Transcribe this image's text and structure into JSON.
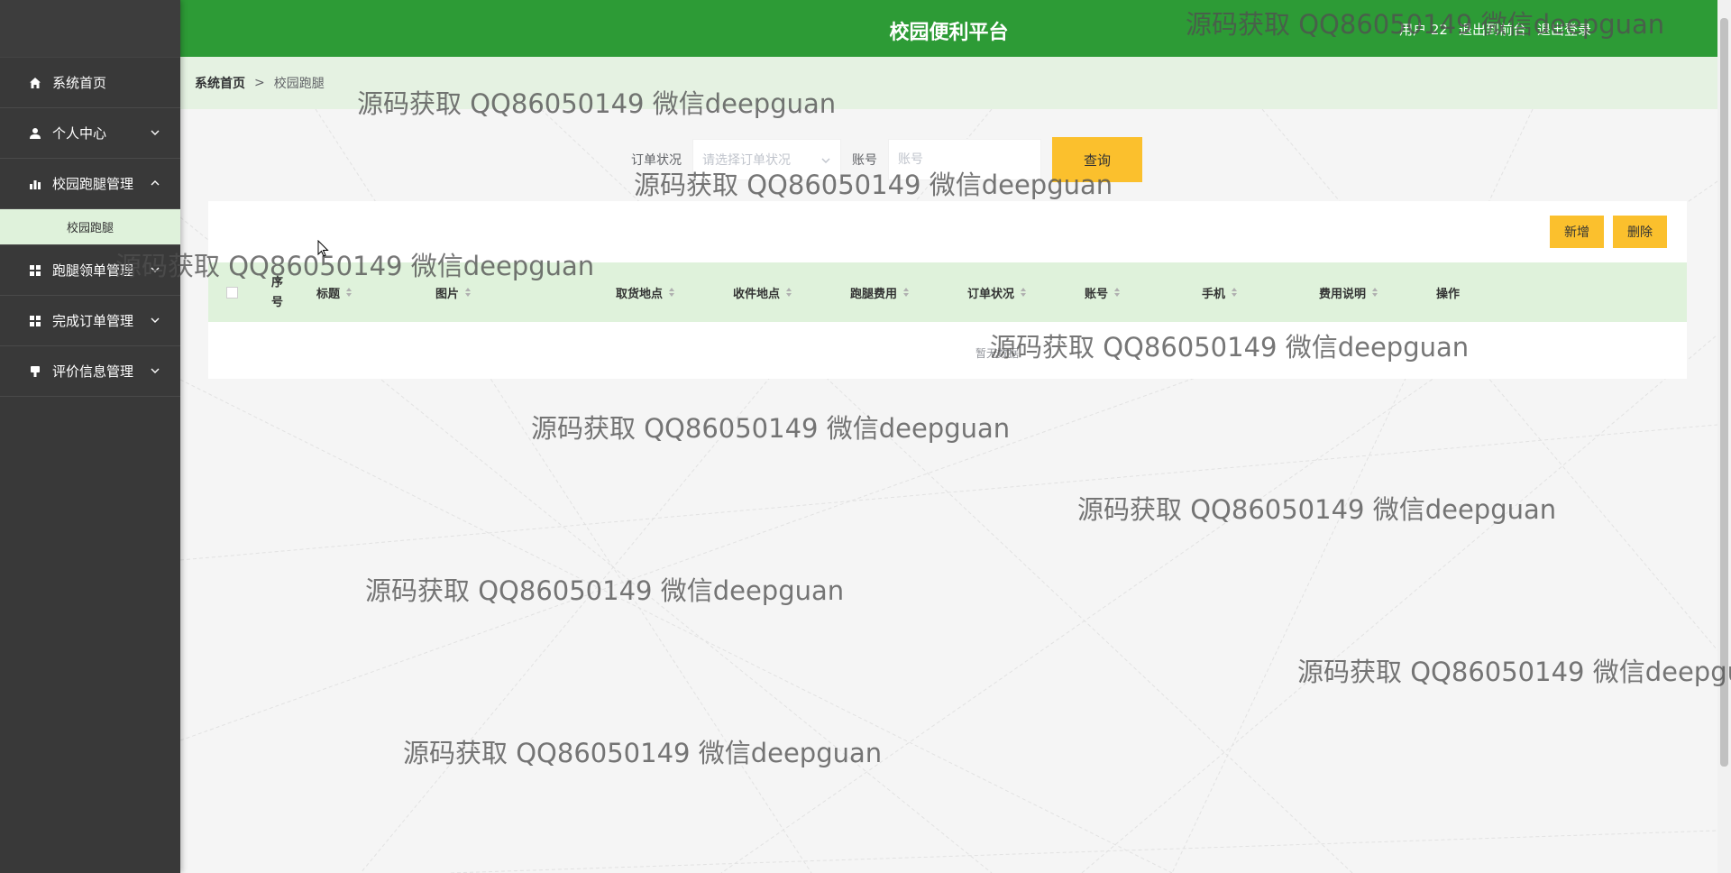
{
  "header": {
    "title": "校园便利平台",
    "user_label": "用户 22",
    "back_to_front": "退出到前台",
    "logout": "退出登录"
  },
  "sidebar": {
    "items": [
      {
        "label": "系统首页",
        "icon": "home-icon"
      },
      {
        "label": "个人中心",
        "icon": "user-icon"
      },
      {
        "label": "校园跑腿管理",
        "icon": "bar-chart-icon",
        "expanded": true,
        "children": [
          {
            "label": "校园跑腿"
          }
        ]
      },
      {
        "label": "跑腿领单管理",
        "icon": "grid-icon"
      },
      {
        "label": "完成订单管理",
        "icon": "grid-icon"
      },
      {
        "label": "评价信息管理",
        "icon": "stamp-icon"
      }
    ]
  },
  "breadcrumb": {
    "home": "系统首页",
    "separator": ">",
    "current": "校园跑腿"
  },
  "search": {
    "status_label": "订单状况",
    "status_placeholder": "请选择订单状况",
    "account_label": "账号",
    "account_placeholder": "账号",
    "query_button": "查询"
  },
  "toolbar": {
    "add_button": "新增",
    "delete_button": "删除"
  },
  "table": {
    "index_header": "序号",
    "columns": [
      "标题",
      "图片",
      "取货地点",
      "收件地点",
      "跑腿费用",
      "订单状况",
      "账号",
      "手机",
      "费用说明",
      "操作"
    ],
    "empty_text": "暂无数据"
  },
  "watermark": {
    "text": "源码获取 QQ86050149 微信deepguan"
  },
  "colors": {
    "header_green": "#2d9b36",
    "sidebar_dark": "#393939",
    "light_green": "#dff2db",
    "button_yellow": "#fbc02d"
  }
}
